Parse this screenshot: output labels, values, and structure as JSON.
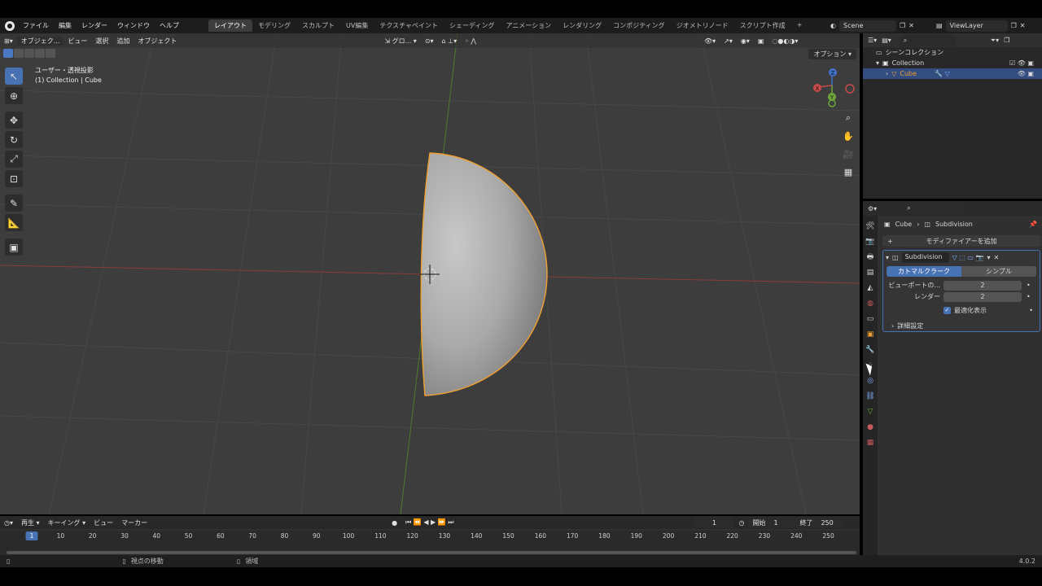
{
  "topbar": {
    "menus": [
      "ファイル",
      "編集",
      "レンダー",
      "ウィンドウ",
      "ヘルプ"
    ],
    "workspaces": [
      "レイアウト",
      "モデリング",
      "スカルプト",
      "UV編集",
      "テクスチャペイント",
      "シェーディング",
      "アニメーション",
      "レンダリング",
      "コンポジティング",
      "ジオメトリノード",
      "スクリプト作成"
    ],
    "active_workspace": "レイアウト",
    "add_tab": "+",
    "scene": "Scene",
    "view_layer": "ViewLayer"
  },
  "viewport": {
    "mode": "オブジェク...",
    "menus": [
      "ビュー",
      "選択",
      "追加",
      "オブジェクト"
    ],
    "transform_orientation": "グロ...",
    "options_label": "オプション",
    "info_line1": "ユーザー・透視投影",
    "info_line2": "(1) Collection | Cube",
    "gizmo_axes": [
      "X",
      "Y",
      "Z"
    ]
  },
  "outliner": {
    "root": "シーンコレクション",
    "collection": "Collection",
    "object": "Cube"
  },
  "properties": {
    "breadcrumb_object": "Cube",
    "breadcrumb_modifier": "Subdivision",
    "add_modifier": "モディファイアーを追加",
    "modifier_name": "Subdivision",
    "type_catmull": "カトマルクラーク",
    "type_simple": "シンプル",
    "viewport_label": "ビューポートの...",
    "viewport_value": "2",
    "render_label": "レンダー",
    "render_value": "2",
    "optimal_display": "最適化表示",
    "advanced": "詳細設定"
  },
  "timeline": {
    "menus": [
      "再生",
      "キーイング",
      "ビュー",
      "マーカー"
    ],
    "current_frame": "1",
    "start_label": "開始",
    "start_value": "1",
    "end_label": "終了",
    "end_value": "250",
    "ticks": [
      "10",
      "20",
      "30",
      "40",
      "50",
      "60",
      "70",
      "80",
      "90",
      "100",
      "110",
      "120",
      "130",
      "140",
      "150",
      "160",
      "170",
      "180",
      "190",
      "200",
      "210",
      "220",
      "230",
      "240",
      "250"
    ]
  },
  "statusbar": {
    "hint_left": "視点の移動",
    "hint_right": "領域",
    "version": "4.0.2"
  },
  "colors": {
    "accent": "#4772b3",
    "selection_outline": "#f0a030",
    "x_axis": "#c84a4a",
    "y_axis": "#6ea83a"
  }
}
